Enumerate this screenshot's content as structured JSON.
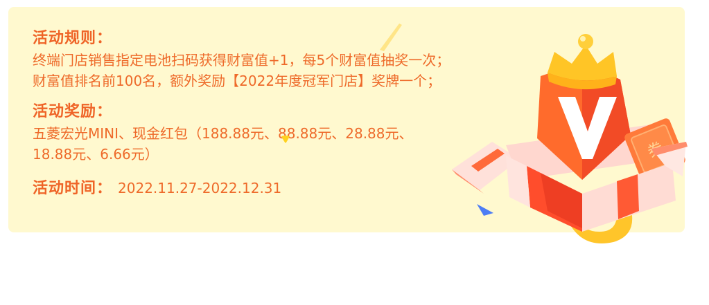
{
  "rules": {
    "heading": "活动规则：",
    "lines": [
      "终端门店销售指定电池扫码获得财富值+1，每5个财富值抽奖一次；",
      "财富值排名前100名，额外奖励【2022年度冠军门店】奖牌一个；"
    ]
  },
  "rewards": {
    "heading": "活动奖励：",
    "lines": [
      "五菱宏光MINI、现金红包（188.88元、88.88元、28.88元、",
      "18.88元、6.66元）"
    ]
  },
  "time": {
    "heading": "活动时间：",
    "value": "2022.11.27-2022.12.31"
  },
  "illustration": {
    "badge_letter": "V",
    "coupon_text": "券"
  },
  "colors": {
    "card_bg": "#fff9cf",
    "text_orange": "#ee6a2a",
    "crown_gold": "#ffc526",
    "box_red": "#f5492c"
  }
}
